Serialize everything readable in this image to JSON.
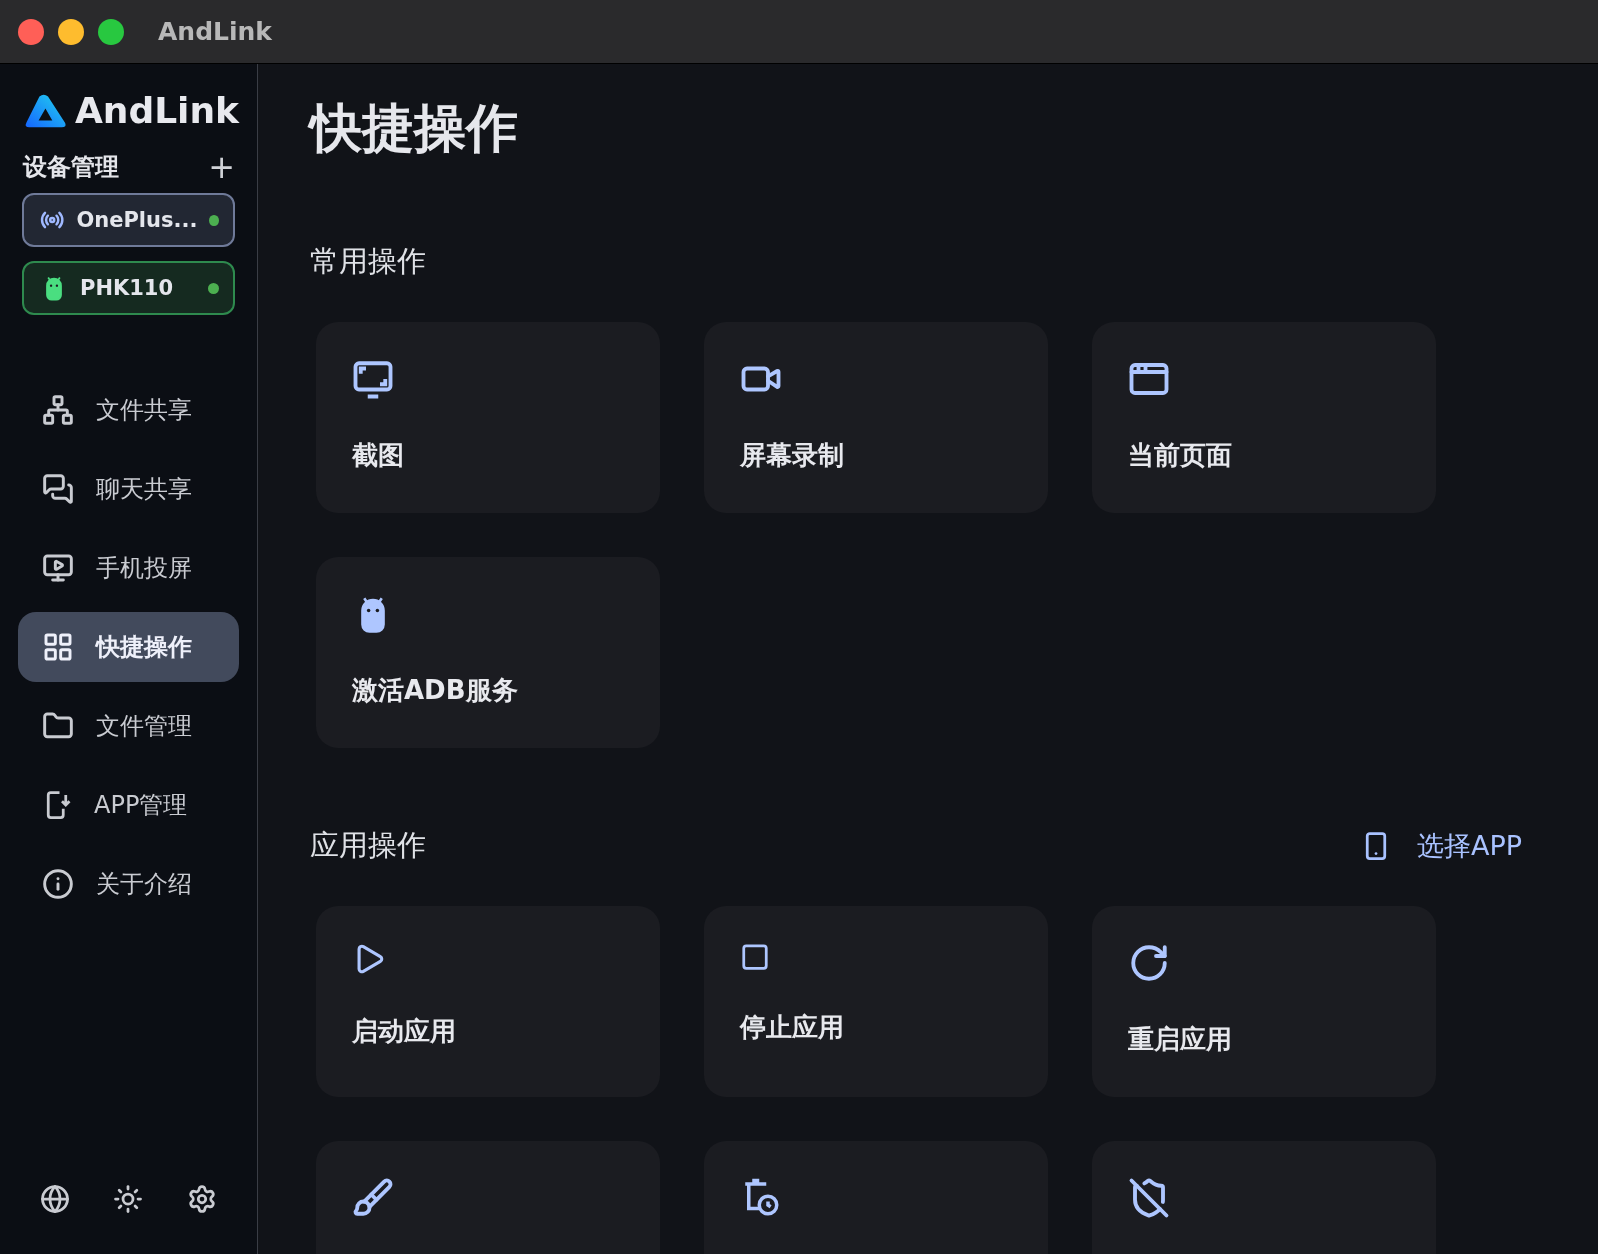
{
  "window": {
    "title": "AndLink"
  },
  "sidebar": {
    "logo": "AndLink",
    "devices_heading": "设备管理",
    "add_label": "+",
    "devices": [
      {
        "name": "OnePlus...",
        "kind": "wireless",
        "online": true
      },
      {
        "name": "PHK110",
        "kind": "usb",
        "online": true
      }
    ],
    "nav": [
      {
        "label": "文件共享",
        "selected": false
      },
      {
        "label": "聊天共享",
        "selected": false
      },
      {
        "label": "手机投屏",
        "selected": false
      },
      {
        "label": "快捷操作",
        "selected": true
      },
      {
        "label": "文件管理",
        "selected": false
      },
      {
        "label": "APP管理",
        "selected": false
      },
      {
        "label": "关于介绍",
        "selected": false
      }
    ]
  },
  "main": {
    "title": "快捷操作",
    "common": {
      "heading": "常用操作",
      "cards": [
        {
          "kind": "full",
          "label": "截图"
        },
        {
          "kind": "full",
          "label": "屏幕录制"
        },
        {
          "kind": "full",
          "label": "当前页面"
        },
        {
          "kind": "full",
          "label": "激活ADB服务"
        }
      ]
    },
    "app": {
      "heading": "应用操作",
      "select_label": "选择APP",
      "cards": [
        {
          "kind": "full",
          "label": "启动应用"
        },
        {
          "kind": "full",
          "label": "停止应用"
        },
        {
          "kind": "full",
          "label": "重启应用"
        },
        {
          "kind": "partial"
        },
        {
          "kind": "partial"
        },
        {
          "kind": "partial"
        }
      ]
    }
  }
}
